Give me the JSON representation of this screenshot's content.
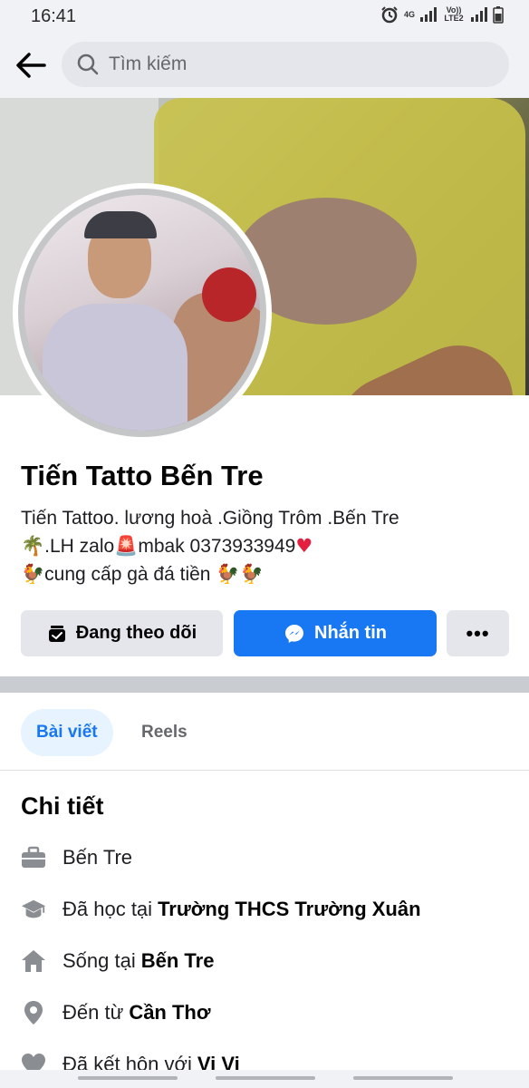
{
  "status_bar": {
    "time": "16:41",
    "network_1": "4G",
    "network_2": "Vo)) LTE2",
    "icons": [
      "alarm-icon",
      "signal-icon",
      "signal-icon",
      "battery-icon"
    ]
  },
  "header": {
    "back_icon": "arrow-left-icon",
    "search_placeholder": "Tìm kiếm"
  },
  "profile": {
    "name": "Tiến Tatto Bến Tre",
    "bio_line1": "Tiến Tattoo.  lương hoà .Giồng  Trôm .Bến Tre",
    "bio_line2_a": "🌴",
    "bio_line2_b": ".LH zalo",
    "bio_line2_c": "🚨",
    "bio_line2_d": "mbak 0373933949",
    "bio_line2_e": "♥",
    "bio_line3_a": "🐓",
    "bio_line3_b": "cung cấp gà đá tiền ",
    "bio_line3_c": "🐓🐓"
  },
  "actions": {
    "follow_label": "Đang theo dõi",
    "message_label": "Nhắn tin",
    "more_label": "•••"
  },
  "tabs": [
    {
      "label": "Bài viết",
      "active": true
    },
    {
      "label": "Reels",
      "active": false
    }
  ],
  "details": {
    "title": "Chi tiết",
    "items": [
      {
        "icon": "briefcase-icon",
        "prefix": "Bến Tre",
        "bold": ""
      },
      {
        "icon": "graduation-cap-icon",
        "prefix": "Đã học tại",
        "bold": "Trường THCS Trường Xuân"
      },
      {
        "icon": "home-icon",
        "prefix": "Sống tại",
        "bold": "Bến Tre"
      },
      {
        "icon": "location-pin-icon",
        "prefix": "Đến từ",
        "bold": "Cần Thơ"
      },
      {
        "icon": "heart-icon",
        "prefix": "Đã kết hôn với",
        "bold": "Vi Vi"
      }
    ]
  },
  "colors": {
    "accent": "#1877f2",
    "accent_light": "#e7f3ff",
    "button_gray": "#e4e6eb",
    "text_secondary": "#65676b"
  }
}
